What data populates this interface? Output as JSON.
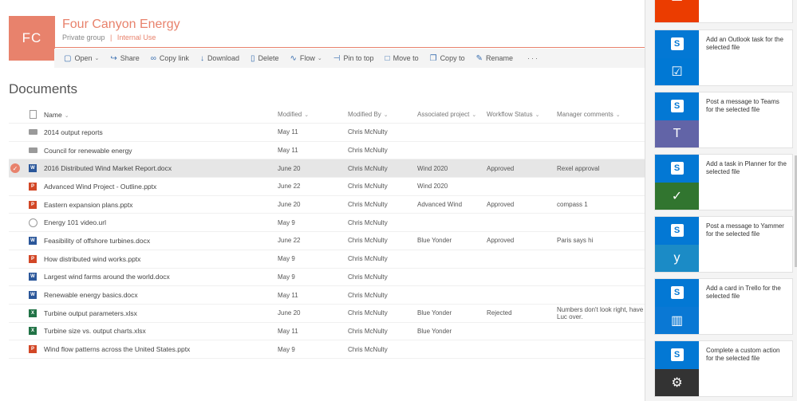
{
  "site": {
    "logo": "FC",
    "title": "Four Canyon Energy",
    "group": "Private group",
    "separator": "|",
    "classification": "Internal Use"
  },
  "commands": [
    {
      "label": "Open",
      "icon": "open-icon",
      "dropdown": true
    },
    {
      "label": "Share",
      "icon": "share-icon",
      "dropdown": false
    },
    {
      "label": "Copy link",
      "icon": "link-icon",
      "dropdown": false
    },
    {
      "label": "Download",
      "icon": "download-icon",
      "dropdown": false
    },
    {
      "label": "Delete",
      "icon": "delete-icon",
      "dropdown": false
    },
    {
      "label": "Flow",
      "icon": "flow-icon",
      "dropdown": true
    },
    {
      "label": "Pin to top",
      "icon": "pin-icon",
      "dropdown": false
    },
    {
      "label": "Move to",
      "icon": "move-icon",
      "dropdown": false
    },
    {
      "label": "Copy to",
      "icon": "copy-icon",
      "dropdown": false
    },
    {
      "label": "Rename",
      "icon": "rename-icon",
      "dropdown": false
    }
  ],
  "more": "···",
  "library": {
    "title": "Documents",
    "columns": {
      "name": "Name",
      "modified": "Modified",
      "modified_by": "Modified By",
      "project": "Associated project",
      "workflow": "Workflow Status",
      "manager": "Manager comments"
    },
    "rows": [
      {
        "type": "folder",
        "name": "2014 output reports",
        "modified": "May 11",
        "by": "Chris McNulty",
        "project": "",
        "workflow": "",
        "manager": "",
        "selected": false
      },
      {
        "type": "folder",
        "name": "Council for renewable energy",
        "modified": "May 11",
        "by": "Chris McNulty",
        "project": "",
        "workflow": "",
        "manager": "",
        "selected": false
      },
      {
        "type": "docx",
        "name": "2016 Distributed Wind Market Report.docx",
        "modified": "June 20",
        "by": "Chris McNulty",
        "project": "Wind 2020",
        "workflow": "Approved",
        "manager": "Rexel approval",
        "selected": true
      },
      {
        "type": "pptx",
        "name": "Advanced Wind Project - Outline.pptx",
        "modified": "June 22",
        "by": "Chris McNulty",
        "project": "Wind 2020",
        "workflow": "",
        "manager": "",
        "selected": false
      },
      {
        "type": "pptx",
        "name": "Eastern expansion plans.pptx",
        "modified": "June 20",
        "by": "Chris McNulty",
        "project": "Advanced Wind",
        "workflow": "Approved",
        "manager": "compass 1",
        "selected": false
      },
      {
        "type": "url",
        "name": "Energy 101 video.url",
        "modified": "May 9",
        "by": "Chris McNulty",
        "project": "",
        "workflow": "",
        "manager": "",
        "selected": false
      },
      {
        "type": "docx",
        "name": "Feasibility of offshore turbines.docx",
        "modified": "June 22",
        "by": "Chris McNulty",
        "project": "Blue Yonder",
        "workflow": "Approved",
        "manager": "Paris says hi",
        "selected": false
      },
      {
        "type": "pptx",
        "name": "How distributed wind works.pptx",
        "modified": "May 9",
        "by": "Chris McNulty",
        "project": "",
        "workflow": "",
        "manager": "",
        "selected": false
      },
      {
        "type": "docx",
        "name": "Largest wind farms around the world.docx",
        "modified": "May 9",
        "by": "Chris McNulty",
        "project": "",
        "workflow": "",
        "manager": "",
        "selected": false
      },
      {
        "type": "docx",
        "name": "Renewable energy basics.docx",
        "modified": "May 11",
        "by": "Chris McNulty",
        "project": "",
        "workflow": "",
        "manager": "",
        "selected": false
      },
      {
        "type": "xlsx",
        "name": "Turbine output parameters.xlsx",
        "modified": "June 20",
        "by": "Chris McNulty",
        "project": "Blue Yonder",
        "workflow": "Rejected",
        "manager": "Numbers don't look right, have Luc over.",
        "selected": false
      },
      {
        "type": "xlsx",
        "name": "Turbine size vs. output charts.xlsx",
        "modified": "May 11",
        "by": "Chris McNulty",
        "project": "Blue Yonder",
        "workflow": "",
        "manager": "",
        "selected": false
      },
      {
        "type": "pptx",
        "name": "Wind flow patterns across the United States.pptx",
        "modified": "May 9",
        "by": "Chris McNulty",
        "project": "",
        "workflow": "",
        "manager": "",
        "selected": false
      }
    ]
  },
  "flows": [
    {
      "text": "",
      "tile": "office-icon",
      "tile_class": "t-office",
      "sharepoint": false
    },
    {
      "text": "Add an Outlook task for the selected file",
      "tile": "checkmark-icon",
      "tile_class": "t-outlook",
      "sharepoint": true
    },
    {
      "text": "Post a message to Teams for the selected file",
      "tile": "teams-icon",
      "tile_class": "t-teams",
      "sharepoint": true
    },
    {
      "text": "Add a task in Planner for the selected file",
      "tile": "planner-icon",
      "tile_class": "t-planner",
      "sharepoint": true
    },
    {
      "text": "Post a message to Yammer for the selected file",
      "tile": "yammer-icon",
      "tile_class": "t-yammer",
      "sharepoint": true
    },
    {
      "text": "Add a card in Trello for the selected file",
      "tile": "trello-icon",
      "tile_class": "t-trello",
      "sharepoint": true
    },
    {
      "text": "Complete a custom action for the selected file",
      "tile": "gear-icon",
      "tile_class": "t-custom",
      "sharepoint": true
    }
  ],
  "colors": {
    "accent": "#e8826c",
    "sharepoint": "#0378d4"
  }
}
